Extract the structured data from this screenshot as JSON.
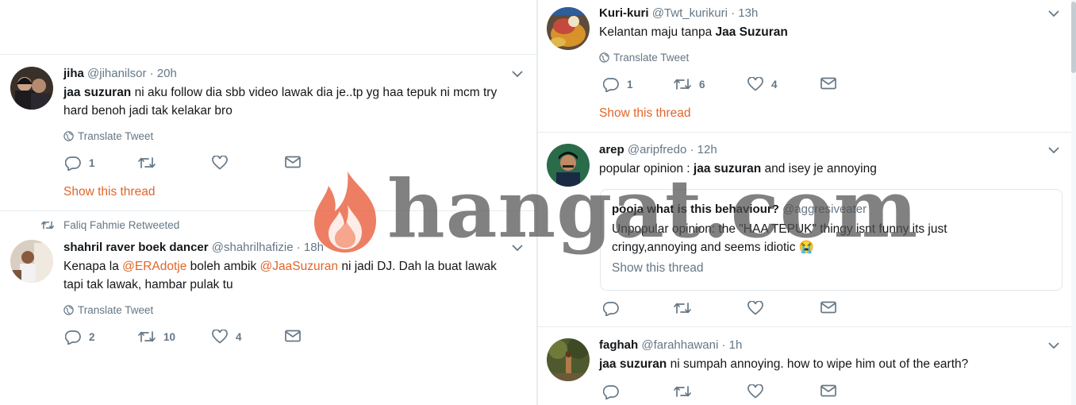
{
  "left_column": {
    "tweets": [
      {
        "name": "jiha",
        "handle": "@jihanilsor",
        "time": "20h",
        "text_mention": "jaa suzuran",
        "text_line1": " ni aku follow dia sbb video lawak dia je..tp yg haa tepuk ni mcm try",
        "text_line2": "hard benoh jadi tak kelakar bro",
        "translate": "Translate Tweet",
        "replies": "1",
        "retweets": "",
        "likes": "",
        "show_thread": "Show this thread"
      },
      {
        "retweeted_by": "Faliq Fahmie Retweeted",
        "name": "shahril raver boek dancer",
        "handle": "@shahrilhafizie",
        "time": "18h",
        "text_line1_a": "Kenapa la ",
        "mention1": "@ERAdotje",
        "text_line1_b": " boleh ambik ",
        "mention2": "@JaaSuzuran",
        "text_line1_c": " ni jadi DJ. Dah la buat lawak",
        "text_line2": "tapi tak lawak, hambar pulak tu",
        "translate": "Translate Tweet",
        "replies": "2",
        "retweets": "10",
        "likes": "4"
      }
    ]
  },
  "right_column": {
    "tweets": [
      {
        "name": "Kuri-kuri",
        "handle": "@Twt_kurikuri",
        "time": "13h",
        "text_a": "Kelantan maju tanpa ",
        "text_bold": "Jaa Suzuran",
        "translate": "Translate Tweet",
        "replies": "1",
        "retweets": "6",
        "likes": "4",
        "show_thread": "Show this thread"
      },
      {
        "name": "arep",
        "handle": "@aripfredo",
        "time": "12h",
        "text_a": "popular opinion : ",
        "text_bold": "jaa suzuran",
        "text_b": " and isey je annoying",
        "quote": {
          "name": "pooja what is this behaviour?",
          "handle": "@aggresiveater",
          "line1": "Unpopular opinion: the \"HAA TEPUK\" thingy isnt funny its just",
          "line2": "cringy,annoying and seems idiotic 😭",
          "show_thread": "Show this thread"
        }
      },
      {
        "name": "faghah",
        "handle": "@farahhawani",
        "time": "1h",
        "text_bold": "jaa suzuran",
        "text_b": " ni sumpah annoying. how to wipe him out of the earth?"
      }
    ]
  },
  "separator_dot": "·",
  "watermark": {
    "text": "hangat.com"
  },
  "colors": {
    "accent": "#e0662a",
    "muted": "#657786",
    "border": "#e6ecf0"
  }
}
